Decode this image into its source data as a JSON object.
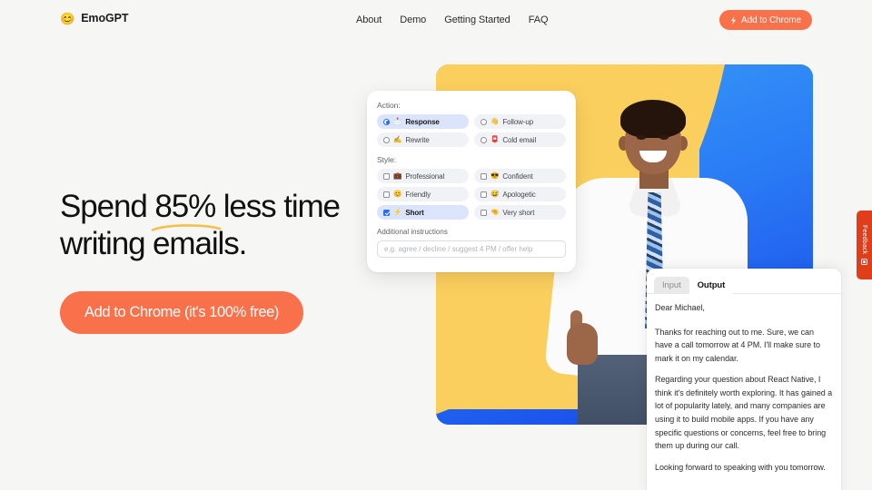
{
  "nav": {
    "brand_emoji": "😊",
    "brand_name": "EmoGPT",
    "links": [
      {
        "label": "About"
      },
      {
        "label": "Demo"
      },
      {
        "label": "Getting Started"
      },
      {
        "label": "FAQ"
      }
    ],
    "cta_label": "Add to Chrome",
    "cta_icon": "chrome-extension-icon",
    "cta_color": "#f9714b"
  },
  "hero": {
    "title_part1": "Spend ",
    "title_highlight": "85%",
    "title_part2": " less time writing emails.",
    "highlight_underline_color": "#f2c14b",
    "cta_label": "Add to Chrome (it's 100% free)",
    "cta_color": "#f9714b"
  },
  "action_card": {
    "action_label": "Action:",
    "actions": [
      {
        "emoji": "📩",
        "label": "Response",
        "selected": true,
        "control": "radio"
      },
      {
        "emoji": "👋",
        "label": "Follow-up",
        "selected": false,
        "control": "radio"
      },
      {
        "emoji": "✍️",
        "label": "Rewrite",
        "selected": false,
        "control": "radio"
      },
      {
        "emoji": "📮",
        "label": "Cold email",
        "selected": false,
        "control": "radio"
      }
    ],
    "style_label": "Style:",
    "styles": [
      {
        "emoji": "💼",
        "label": "Professional",
        "selected": false,
        "control": "checkbox"
      },
      {
        "emoji": "😎",
        "label": "Confident",
        "selected": false,
        "control": "checkbox"
      },
      {
        "emoji": "😊",
        "label": "Friendly",
        "selected": false,
        "control": "checkbox"
      },
      {
        "emoji": "😅",
        "label": "Apologetic",
        "selected": false,
        "control": "checkbox"
      },
      {
        "emoji": "⚡",
        "label": "Short",
        "selected": true,
        "control": "checkbox"
      },
      {
        "emoji": "🤏",
        "label": "Very short",
        "selected": false,
        "control": "checkbox"
      }
    ],
    "additional_label": "Additional instructions",
    "additional_placeholder": "e.g. agree / decline / suggest 4 PM / offer help",
    "additional_value": ""
  },
  "output_panel": {
    "tab_input": "Input",
    "tab_output": "Output",
    "active_tab": "Output",
    "paragraphs": [
      "Dear Michael,",
      "Thanks for reaching out to me. Sure, we can have a call tomorrow at 4 PM. I'll make sure to mark it on my calendar.",
      "Regarding your question about React Native, I think it's definitely worth exploring. It has gained a lot of popularity lately, and many companies are using it to build mobile apps. If you have any specific questions or concerns, feel free to bring them up during our call.",
      "Looking forward to speaking with you tomorrow."
    ]
  },
  "feedback": {
    "label": "Feedback",
    "icon": "feedback-icon",
    "color": "#e03e1a"
  },
  "colors": {
    "page_background": "#f6f6f5",
    "photo_yellow": "#fbcf5d",
    "photo_blue": "#1763f5",
    "accent_orange": "#f9714b",
    "selected_pill": "#dce4fb"
  }
}
